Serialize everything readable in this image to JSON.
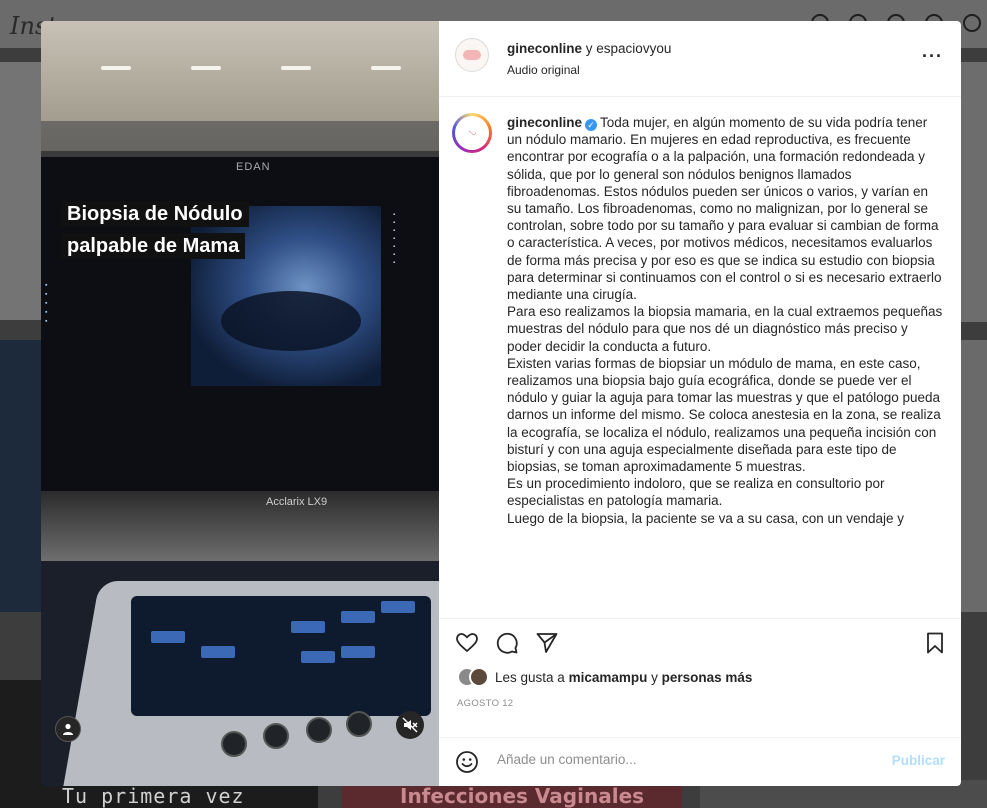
{
  "background": {
    "logo_text": "Inst",
    "tile_captions": [
      "Tu primera vez",
      "Infecciones Vaginales"
    ]
  },
  "video": {
    "overlay_title": "Biopsia de Nódulo palpable de Mama",
    "monitor_brand": "EDAN",
    "device_brand": "Acclarix LX9"
  },
  "post": {
    "header": {
      "username": "gineconline",
      "collab_text": "y espaciovyou",
      "audio": "Audio original",
      "more_icon": "more-horizontal-icon"
    },
    "caption": {
      "username": "gineconline",
      "paragraphs": [
        "Toda mujer, en algún momento de su vida podría tener un nódulo mamario. En mujeres en edad reproductiva, es frecuente encontrar por ecografía o a la palpación, una formación redondeada y sólida, que por lo general son nódulos benignos llamados fibroadenomas. Estos nódulos pueden ser únicos o varios, y varían en su tamaño. Los fibroadenomas, como no malignizan, por lo general se controlan, sobre todo por su tamaño y para evaluar si cambian de forma o característica. A veces, por motivos médicos, necesitamos evaluarlos de forma más precisa y por eso es que se indica su estudio con biopsia para determinar si continuamos con el control o si es necesario extraerlo mediante una cirugía.",
        "Para eso realizamos la biopsia mamaria, en la cual extraemos pequeñas muestras del nódulo para que nos dé un diagnóstico más preciso y poder decidir la conducta a futuro.",
        "Existen varias formas de biopsiar un módulo de mama, en este caso, realizamos una biopsia bajo guía ecográfica, donde se puede ver el nódulo y guiar la aguja para tomar las muestras y que el patólogo pueda darnos un informe del mismo. Se coloca anestesia en la zona, se realiza la ecografía, se localiza el nódulo, realizamos una pequeña incisión con bisturí y con una aguja especialmente diseñada para este tipo de biopsias, se toman aproximadamente 5 muestras.",
        "Es un procedimiento indoloro, que se realiza en consultorio por especialistas en patología mamaria.",
        "Luego de la biopsia, la paciente se va a su casa, con un vendaje y"
      ]
    },
    "likes": {
      "prefix": "Les gusta a",
      "user": "micamampu",
      "suffix": "y",
      "others": "personas más"
    },
    "date": "AGOSTO 12",
    "comment": {
      "placeholder": "Añade un comentario...",
      "publish_label": "Publicar"
    }
  },
  "colors": {
    "accent": "#0095f6",
    "publish_disabled": "#b2dffc",
    "verified": "#3897f0",
    "muted_text": "#8e8e8e"
  }
}
